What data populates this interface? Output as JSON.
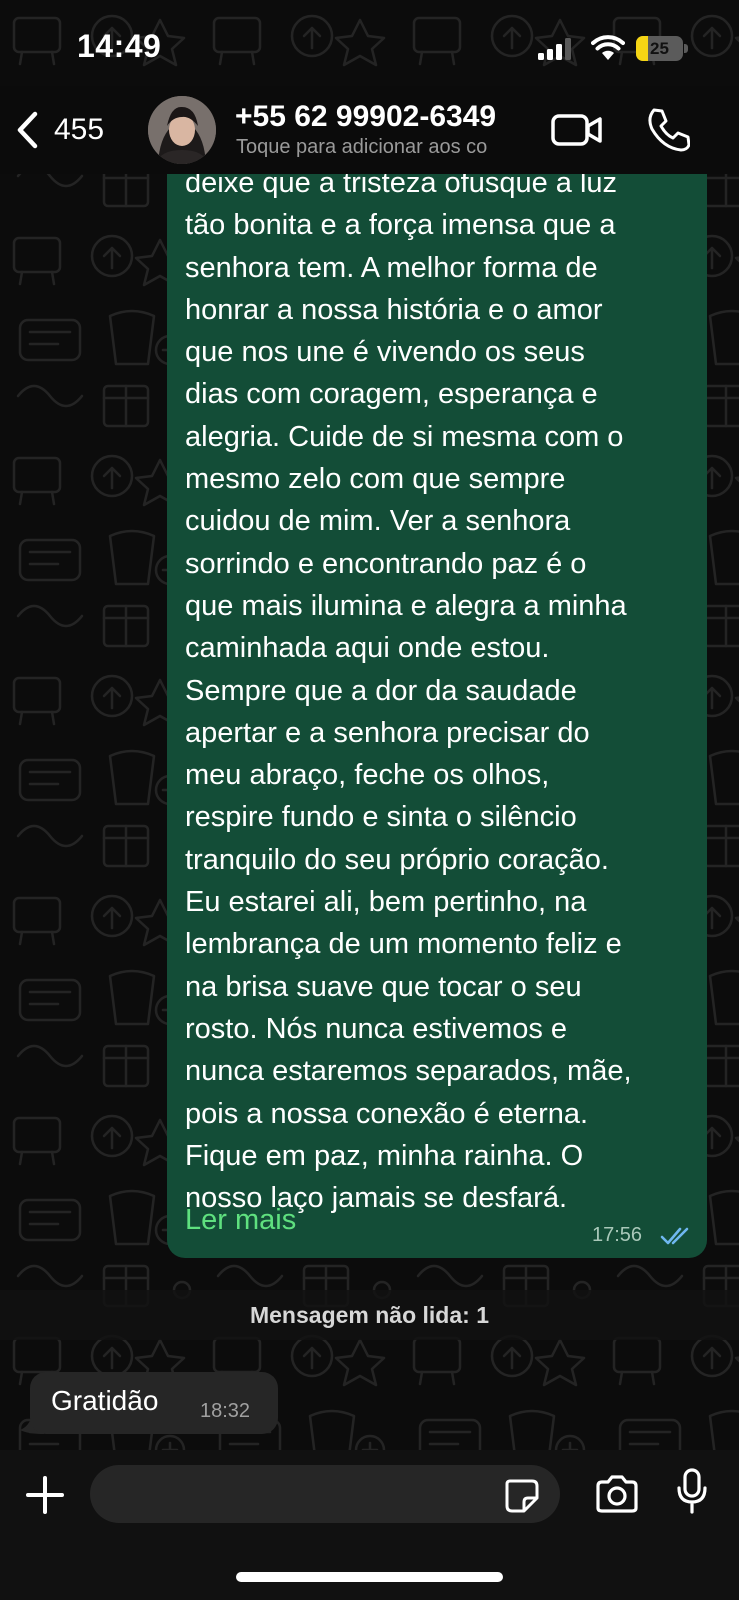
{
  "status_bar": {
    "time": "14:49",
    "battery_level": "25",
    "battery_fraction": 0.25,
    "icons": [
      "signal-icon",
      "wifi-icon",
      "battery-icon"
    ]
  },
  "header": {
    "back_count": "455",
    "contact_name": "+55 62 99902-6349",
    "subtitle": "Toque para adicionar aos co",
    "icons": [
      "back-chevron-icon",
      "video-camera-icon",
      "phone-icon"
    ]
  },
  "messages": {
    "outgoing": {
      "text": "deixe que a tristeza ofusque a luz\ntão bonita e a força imensa que a\nsenhora tem. A melhor forma de\nhonrar a nossa história e o amor\nque nos une é vivendo os seus\ndias com coragem, esperança e\nalegria. Cuide de si mesma com o\nmesmo zelo com que sempre\ncuidou de mim. Ver a senhora\nsorrindo e encontrando paz é o\nque mais ilumina e alegra a minha\ncaminhada aqui onde estou.\nSempre que a dor da saudade\napertar e a senhora precisar do\nmeu abraço, feche os olhos,\nrespire fundo e sinta o silêncio\ntranquilo do seu próprio coração.\nEu estarei ali, bem pertinho, na\nlembrança de um momento feliz e\nna brisa suave que tocar o seu\nrosto. Nós nunca estivemos e\nnunca estaremos separados, mãe,\npois a nossa conexão é eterna.\nFique em paz, minha rainha. O\nnosso laço jamais se desfará.",
      "read_more": "Ler mais",
      "time": "17:56",
      "status_icon": "double-check-icon"
    },
    "unread_divider": "Mensagem não lida: 1",
    "incoming": {
      "text": "Gratidão",
      "time": "18:32"
    }
  },
  "input_bar": {
    "placeholder": "",
    "icons": [
      "plus-icon",
      "sticker-icon",
      "camera-icon",
      "microphone-icon"
    ]
  },
  "colors": {
    "outgoing_bubble": "#134d37",
    "incoming_bubble": "#262626",
    "read_more": "#5fe07f",
    "read_receipt": "#6fb7f0",
    "battery_fill": "#f5d515"
  }
}
